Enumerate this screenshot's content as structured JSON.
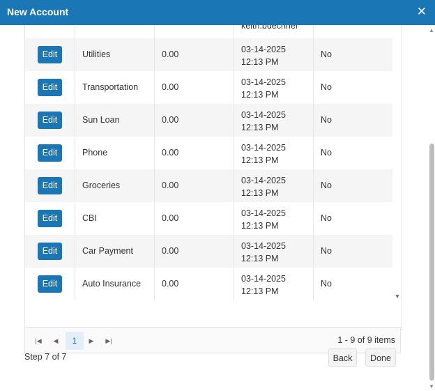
{
  "dialog": {
    "title": "New Account",
    "close_icon": "close-icon"
  },
  "grid": {
    "partial_row_date": "keith.buechner",
    "rows": [
      {
        "button": "Edit",
        "name": "Utilities",
        "amount": "0.00",
        "date": "03-14-2025",
        "time": "12:13 PM",
        "flag": "No"
      },
      {
        "button": "Edit",
        "name": "Transportation",
        "amount": "0.00",
        "date": "03-14-2025",
        "time": "12:13 PM",
        "flag": "No"
      },
      {
        "button": "Edit",
        "name": "Sun Loan",
        "amount": "0.00",
        "date": "03-14-2025",
        "time": "12:13 PM",
        "flag": "No"
      },
      {
        "button": "Edit",
        "name": "Phone",
        "amount": "0.00",
        "date": "03-14-2025",
        "time": "12:13 PM",
        "flag": "No"
      },
      {
        "button": "Edit",
        "name": "Groceries",
        "amount": "0.00",
        "date": "03-14-2025",
        "time": "12:13 PM",
        "flag": "No"
      },
      {
        "button": "Edit",
        "name": "CBI",
        "amount": "0.00",
        "date": "03-14-2025",
        "time": "12:13 PM",
        "flag": "No"
      },
      {
        "button": "Edit",
        "name": "Car Payment",
        "amount": "0.00",
        "date": "03-14-2025",
        "time": "12:13 PM",
        "flag": "No"
      },
      {
        "button": "Edit",
        "name": "Auto Insurance",
        "amount": "0.00",
        "date": "03-14-2025",
        "time": "12:13 PM",
        "flag": "No"
      }
    ]
  },
  "pager": {
    "first_icon": "first-page-icon",
    "prev_icon": "prev-page-icon",
    "current_page": "1",
    "next_icon": "next-page-icon",
    "last_icon": "last-page-icon",
    "info": "1 - 9 of 9 items"
  },
  "footer": {
    "step": "Step 7 of 7",
    "back_label": "Back",
    "done_label": "Done"
  },
  "colors": {
    "accent": "#1a76b4"
  }
}
